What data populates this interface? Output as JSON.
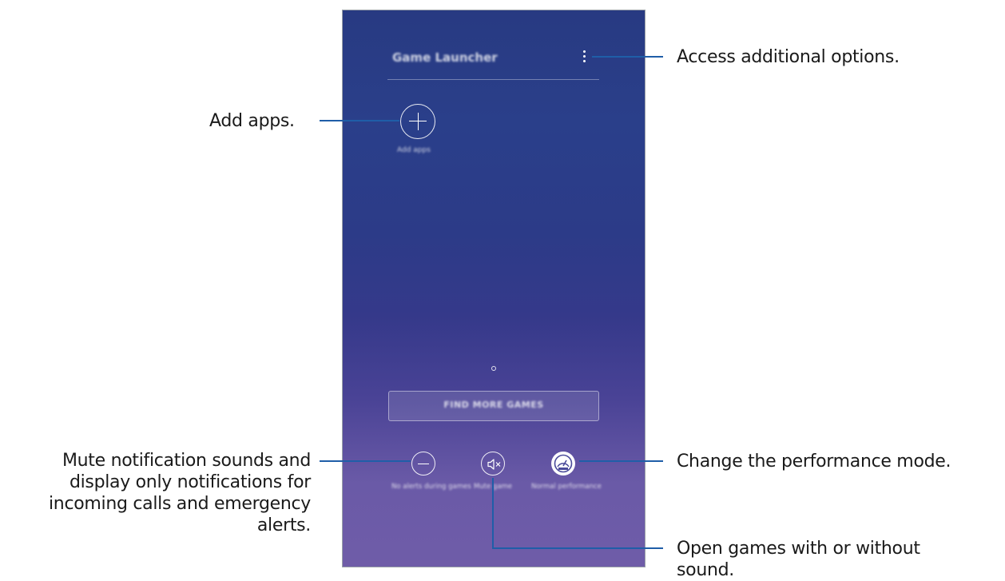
{
  "app": {
    "title": "Game Launcher",
    "add_apps_label": "Add apps",
    "find_more_label": "FIND MORE GAMES",
    "bottom_buttons": [
      {
        "name": "no-alerts",
        "label": "No alerts during games",
        "icon": "minus-circle-icon"
      },
      {
        "name": "mute-game",
        "label": "Mute game",
        "icon": "speaker-mute-icon"
      },
      {
        "name": "performance",
        "label": "Normal performance",
        "icon": "speedometer-icon"
      }
    ]
  },
  "callouts": {
    "options": "Access additional options.",
    "add_apps": "Add apps.",
    "mute_notifications": "Mute notification sounds and display only notifications for incoming calls and emergency alerts.",
    "performance": "Change the performance mode.",
    "sound": "Open games with or without sound."
  },
  "colors": {
    "line": "#1f5ea8",
    "text": "#1a1a1a"
  }
}
